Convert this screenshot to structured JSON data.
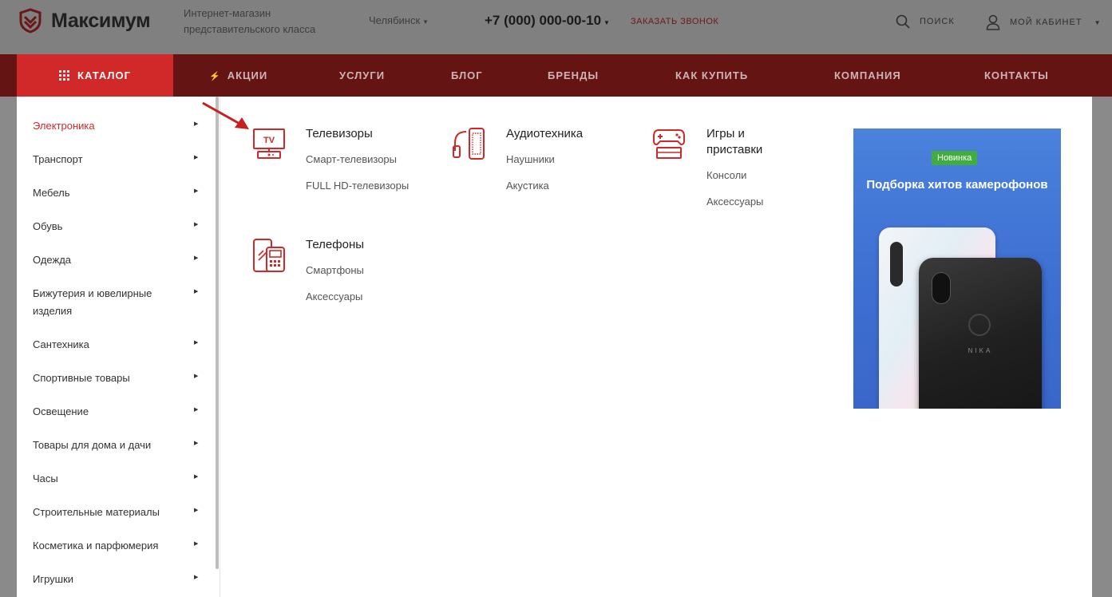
{
  "header": {
    "logo": "Максимум",
    "tagline": "Интернет-магазин представительского класса",
    "city": "Челябинск",
    "phone": "+7 (000) 000-00-10",
    "callback": "ЗАКАЗАТЬ ЗВОНОК",
    "search": "ПОИСК",
    "cabinet": "МОЙ КАБИНЕТ"
  },
  "nav": {
    "catalog": "КАТАЛОГ",
    "items": [
      "АКЦИИ",
      "УСЛУГИ",
      "БЛОГ",
      "БРЕНДЫ",
      "КАК КУПИТЬ",
      "КОМПАНИЯ",
      "КОНТАКТЫ"
    ]
  },
  "sidebar": {
    "items": [
      "Электроника",
      "Транспорт",
      "Мебель",
      "Обувь",
      "Одежда",
      "Бижутерия и ювелирные изделия",
      "Сантехника",
      "Спортивные товары",
      "Освещение",
      "Товары для дома и дачи",
      "Часы",
      "Строительные материалы",
      "Косметика и парфюмерия",
      "Игрушки"
    ],
    "active_index": 0
  },
  "submenu": {
    "groups": [
      {
        "title": "Телевизоры",
        "icon": "tv-icon",
        "links": [
          "Смарт-телевизоры",
          "FULL HD-телевизоры"
        ]
      },
      {
        "title": "Аудиотехника",
        "icon": "headphones-speaker-icon",
        "links": [
          "Наушники",
          "Акустика"
        ]
      },
      {
        "title": "Игры и приставки",
        "icon": "gamepad-icon",
        "links": [
          "Консоли",
          "Аксессуары"
        ]
      },
      {
        "title": "Телефоны",
        "icon": "phones-icon",
        "links": [
          "Смартфоны",
          "Аксессуары"
        ]
      }
    ]
  },
  "promo": {
    "badge": "Новинка",
    "title": "Подборка хитов камерофонов",
    "brand": "NIKA"
  },
  "colors": {
    "accent": "#d12929",
    "nav_bg": "#651414",
    "promo_badge": "#41ad3f"
  }
}
